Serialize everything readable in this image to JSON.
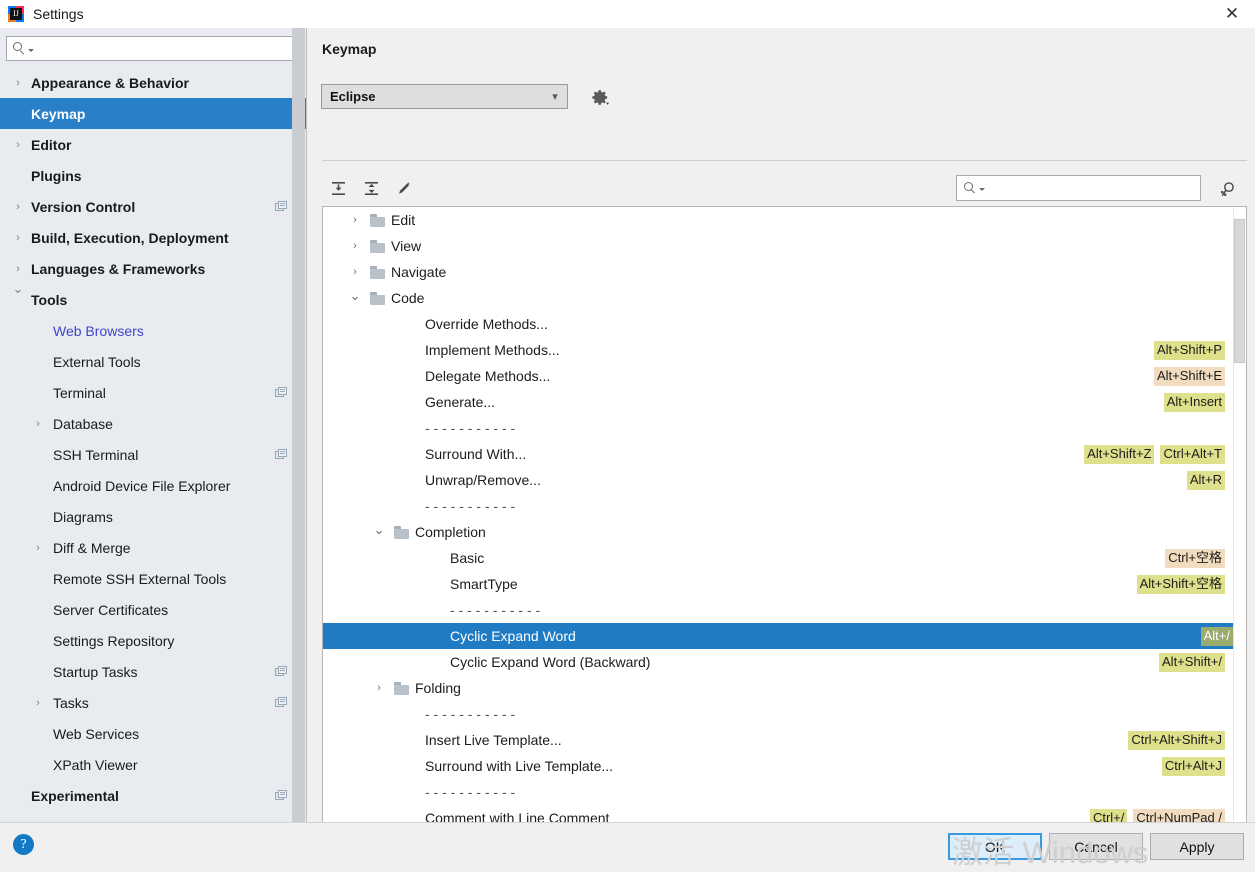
{
  "window": {
    "title": "Settings",
    "logo_icon": "intellij-idea-logo",
    "close_icon": "close-icon"
  },
  "sidebar": {
    "search": {
      "placeholder": "",
      "value": "",
      "icon": "search-icon"
    },
    "items": [
      {
        "label": "Appearance & Behavior",
        "indent": 0,
        "chevron": "right",
        "bold": true,
        "selected": false,
        "link": false,
        "copy": false
      },
      {
        "label": "Keymap",
        "indent": 0,
        "chevron": "",
        "bold": true,
        "selected": true,
        "link": false,
        "copy": false
      },
      {
        "label": "Editor",
        "indent": 0,
        "chevron": "right",
        "bold": true,
        "selected": false,
        "link": false,
        "copy": false
      },
      {
        "label": "Plugins",
        "indent": 0,
        "chevron": "",
        "bold": true,
        "selected": false,
        "link": false,
        "copy": false
      },
      {
        "label": "Version Control",
        "indent": 0,
        "chevron": "right",
        "bold": true,
        "selected": false,
        "link": false,
        "copy": true
      },
      {
        "label": "Build, Execution, Deployment",
        "indent": 0,
        "chevron": "right",
        "bold": true,
        "selected": false,
        "link": false,
        "copy": false
      },
      {
        "label": "Languages & Frameworks",
        "indent": 0,
        "chevron": "right",
        "bold": true,
        "selected": false,
        "link": false,
        "copy": false
      },
      {
        "label": "Tools",
        "indent": 0,
        "chevron": "down",
        "bold": true,
        "selected": false,
        "link": false,
        "copy": false
      },
      {
        "label": "Web Browsers",
        "indent": 1,
        "chevron": "",
        "bold": false,
        "selected": false,
        "link": true,
        "copy": false
      },
      {
        "label": "External Tools",
        "indent": 1,
        "chevron": "",
        "bold": false,
        "selected": false,
        "link": false,
        "copy": false
      },
      {
        "label": "Terminal",
        "indent": 1,
        "chevron": "",
        "bold": false,
        "selected": false,
        "link": false,
        "copy": true
      },
      {
        "label": "Database",
        "indent": 1,
        "chevron": "right",
        "bold": false,
        "selected": false,
        "link": false,
        "copy": false
      },
      {
        "label": "SSH Terminal",
        "indent": 1,
        "chevron": "",
        "bold": false,
        "selected": false,
        "link": false,
        "copy": true
      },
      {
        "label": "Android Device File Explorer",
        "indent": 1,
        "chevron": "",
        "bold": false,
        "selected": false,
        "link": false,
        "copy": false
      },
      {
        "label": "Diagrams",
        "indent": 1,
        "chevron": "",
        "bold": false,
        "selected": false,
        "link": false,
        "copy": false
      },
      {
        "label": "Diff & Merge",
        "indent": 1,
        "chevron": "right",
        "bold": false,
        "selected": false,
        "link": false,
        "copy": false
      },
      {
        "label": "Remote SSH External Tools",
        "indent": 1,
        "chevron": "",
        "bold": false,
        "selected": false,
        "link": false,
        "copy": false
      },
      {
        "label": "Server Certificates",
        "indent": 1,
        "chevron": "",
        "bold": false,
        "selected": false,
        "link": false,
        "copy": false
      },
      {
        "label": "Settings Repository",
        "indent": 1,
        "chevron": "",
        "bold": false,
        "selected": false,
        "link": false,
        "copy": false
      },
      {
        "label": "Startup Tasks",
        "indent": 1,
        "chevron": "",
        "bold": false,
        "selected": false,
        "link": false,
        "copy": true
      },
      {
        "label": "Tasks",
        "indent": 1,
        "chevron": "right",
        "bold": false,
        "selected": false,
        "link": false,
        "copy": true
      },
      {
        "label": "Web Services",
        "indent": 1,
        "chevron": "",
        "bold": false,
        "selected": false,
        "link": false,
        "copy": false
      },
      {
        "label": "XPath Viewer",
        "indent": 1,
        "chevron": "",
        "bold": false,
        "selected": false,
        "link": false,
        "copy": false
      },
      {
        "label": "Experimental",
        "indent": 0,
        "chevron": "",
        "bold": true,
        "selected": false,
        "link": false,
        "copy": true
      }
    ]
  },
  "panel": {
    "title": "Keymap",
    "keymap_select": {
      "value": "Eclipse",
      "chevron_icon": "chevron-down-icon"
    },
    "gear_icon": "gear-icon",
    "toolbar": {
      "expand_all_icon": "expand-all-icon",
      "collapse_all_icon": "collapse-all-icon",
      "edit_icon": "pencil-edit-icon",
      "find_by_shortcut_icon": "find-by-shortcut-icon"
    },
    "search": {
      "placeholder": "",
      "value": "",
      "icon": "search-icon"
    }
  },
  "tree": {
    "rows": [
      {
        "type": "folder",
        "label": "Edit",
        "indent": 0,
        "chevron": "right",
        "shortcuts": []
      },
      {
        "type": "folder",
        "label": "View",
        "indent": 0,
        "chevron": "right",
        "shortcuts": []
      },
      {
        "type": "folder",
        "label": "Navigate",
        "indent": 0,
        "chevron": "right",
        "shortcuts": []
      },
      {
        "type": "folder",
        "label": "Code",
        "indent": 0,
        "chevron": "down",
        "shortcuts": []
      },
      {
        "type": "action",
        "label": "Override Methods...",
        "indent": 1,
        "shortcuts": []
      },
      {
        "type": "action",
        "label": "Implement Methods...",
        "indent": 1,
        "shortcuts": [
          {
            "text": "Alt+Shift+P",
            "style": "y"
          }
        ]
      },
      {
        "type": "action",
        "label": "Delegate Methods...",
        "indent": 1,
        "shortcuts": [
          {
            "text": "Alt+Shift+E",
            "style": "t"
          }
        ]
      },
      {
        "type": "action",
        "label": "Generate...",
        "indent": 1,
        "shortcuts": [
          {
            "text": "Alt+Insert",
            "style": "y"
          }
        ]
      },
      {
        "type": "separator",
        "label": "- - - - - - - - - - -",
        "indent": 1,
        "shortcuts": []
      },
      {
        "type": "action",
        "label": "Surround With...",
        "indent": 1,
        "shortcuts": [
          {
            "text": "Alt+Shift+Z",
            "style": "y"
          },
          {
            "text": "Ctrl+Alt+T",
            "style": "y"
          }
        ]
      },
      {
        "type": "action",
        "label": "Unwrap/Remove...",
        "indent": 1,
        "shortcuts": [
          {
            "text": "Alt+R",
            "style": "y"
          }
        ]
      },
      {
        "type": "separator",
        "label": "- - - - - - - - - - -",
        "indent": 1,
        "shortcuts": []
      },
      {
        "type": "folder",
        "label": "Completion",
        "indent": 1,
        "chevron": "down",
        "shortcuts": []
      },
      {
        "type": "action",
        "label": "Basic",
        "indent": 2,
        "shortcuts": [
          {
            "text": "Ctrl+空格",
            "style": "t"
          }
        ]
      },
      {
        "type": "action",
        "label": "SmartType",
        "indent": 2,
        "shortcuts": [
          {
            "text": "Alt+Shift+空格",
            "style": "y"
          }
        ]
      },
      {
        "type": "separator",
        "label": "- - - - - - - - - - -",
        "indent": 2,
        "shortcuts": []
      },
      {
        "type": "action",
        "label": "Cyclic Expand Word",
        "indent": 2,
        "selected": true,
        "shortcuts": [
          {
            "text": "Alt+/",
            "style": "y"
          }
        ]
      },
      {
        "type": "action",
        "label": "Cyclic Expand Word (Backward)",
        "indent": 2,
        "shortcuts": [
          {
            "text": "Alt+Shift+/",
            "style": "y"
          }
        ]
      },
      {
        "type": "folder",
        "label": "Folding",
        "indent": 1,
        "chevron": "right",
        "shortcuts": []
      },
      {
        "type": "separator",
        "label": "- - - - - - - - - - -",
        "indent": 1,
        "shortcuts": []
      },
      {
        "type": "action",
        "label": "Insert Live Template...",
        "indent": 1,
        "shortcuts": [
          {
            "text": "Ctrl+Alt+Shift+J",
            "style": "y"
          }
        ]
      },
      {
        "type": "action",
        "label": "Surround with Live Template...",
        "indent": 1,
        "shortcuts": [
          {
            "text": "Ctrl+Alt+J",
            "style": "y"
          }
        ]
      },
      {
        "type": "separator",
        "label": "- - - - - - - - - - -",
        "indent": 1,
        "shortcuts": []
      },
      {
        "type": "action",
        "label": "Comment with Line Comment",
        "indent": 1,
        "shortcuts": [
          {
            "text": "Ctrl+/",
            "style": "y"
          },
          {
            "text": "Ctrl+NumPad /",
            "style": "t"
          }
        ]
      }
    ]
  },
  "footer": {
    "help_icon": "help-icon",
    "ok_label": "OK",
    "cancel_label": "Cancel",
    "apply_label": "Apply",
    "watermark": "激活 Windows"
  },
  "colors": {
    "accent_blue": "#1f7cc4",
    "sidebar_bg": "#e8ecf0",
    "badge_yellow": "#dfe08c",
    "badge_tan": "#f2dcbf",
    "link_blue": "#3f46c8"
  }
}
